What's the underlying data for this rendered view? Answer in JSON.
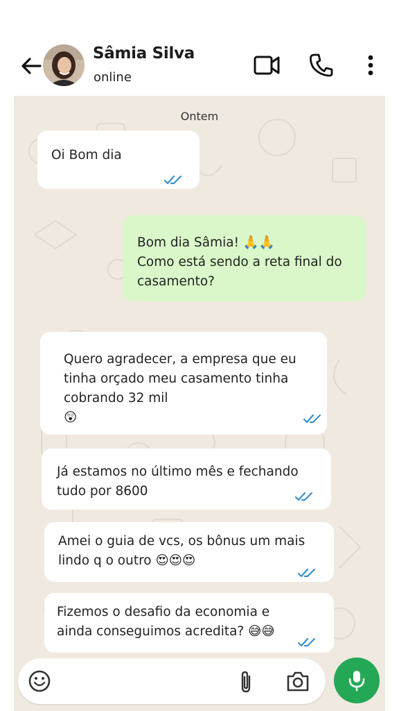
{
  "header": {
    "contact_name": "Sâmia Silva",
    "status": "online"
  },
  "chat": {
    "date_label": "Ontem",
    "messages": [
      {
        "direction": "in",
        "text": "Oi Bom dia",
        "read": true
      },
      {
        "direction": "out",
        "text": "Bom dia Sâmia! 🙏🙏\nComo está sendo a reta final do\ncasamento?",
        "read": false
      },
      {
        "direction": "in",
        "text": "Quero agradecer, a empresa que eu\ntinha orçado meu casamento tinha\ncobrando 32 mil\n😲",
        "read": true
      },
      {
        "direction": "in",
        "text": "Já estamos no último mês e fechando\ntudo por 8600",
        "read": true
      },
      {
        "direction": "in",
        "text": "Amei o guia de vcs, os bônus um mais\nlindo q o outro 😍😍😍",
        "read": true
      },
      {
        "direction": "in",
        "text": "Fizemos o desafio da economia e\nainda conseguimos acredita? 😅😅",
        "read": true
      }
    ]
  },
  "colors": {
    "incoming_bubble": "#ffffff",
    "outgoing_bubble": "#d9f7c8",
    "chat_background": "#efe9e0",
    "mic_button": "#24a856",
    "read_ticks": "#3a8fc9"
  },
  "icons": [
    "arrow-left-icon",
    "video-camera-icon",
    "phone-icon",
    "more-vertical-icon",
    "emoji-icon",
    "paperclip-icon",
    "camera-icon",
    "microphone-icon"
  ]
}
